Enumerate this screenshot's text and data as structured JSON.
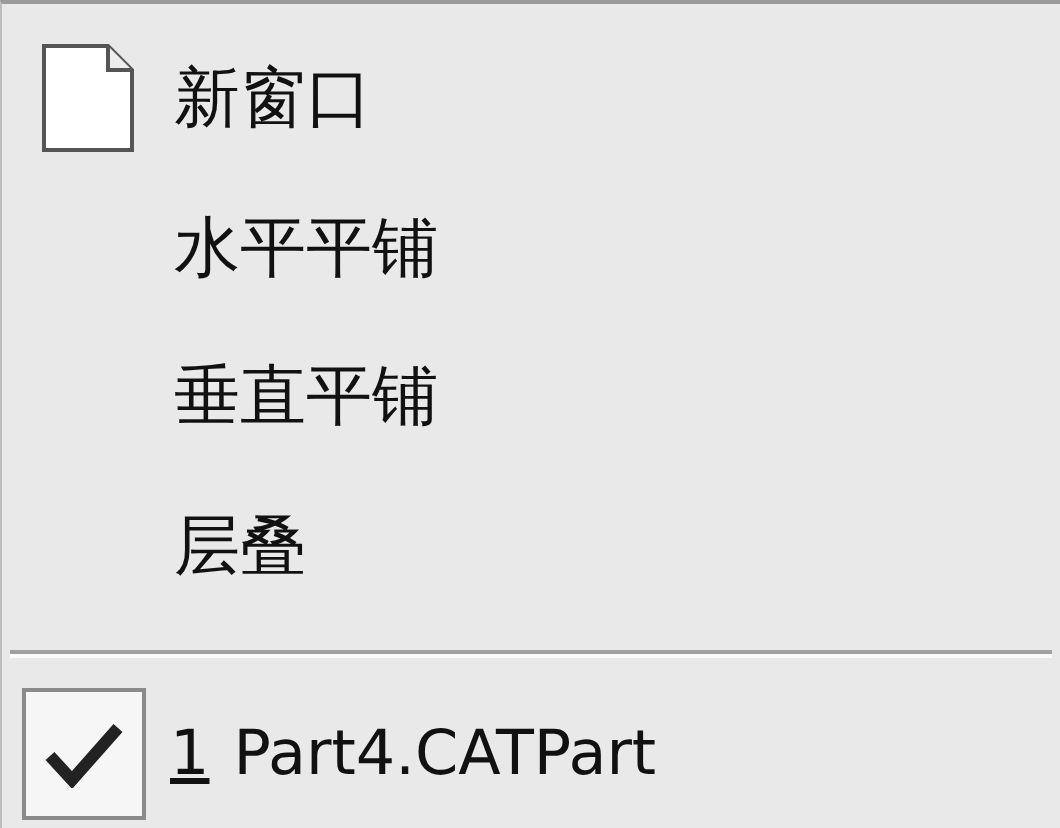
{
  "menu": {
    "items": [
      {
        "kind": "with_icon",
        "label": "新窗口"
      },
      {
        "kind": "plain",
        "label": "水平平铺"
      },
      {
        "kind": "plain",
        "label": "垂直平铺"
      },
      {
        "kind": "plain",
        "label": "层叠"
      }
    ],
    "windows": [
      {
        "number": "1",
        "label": "Part4.CATPart",
        "checked": true
      }
    ]
  }
}
